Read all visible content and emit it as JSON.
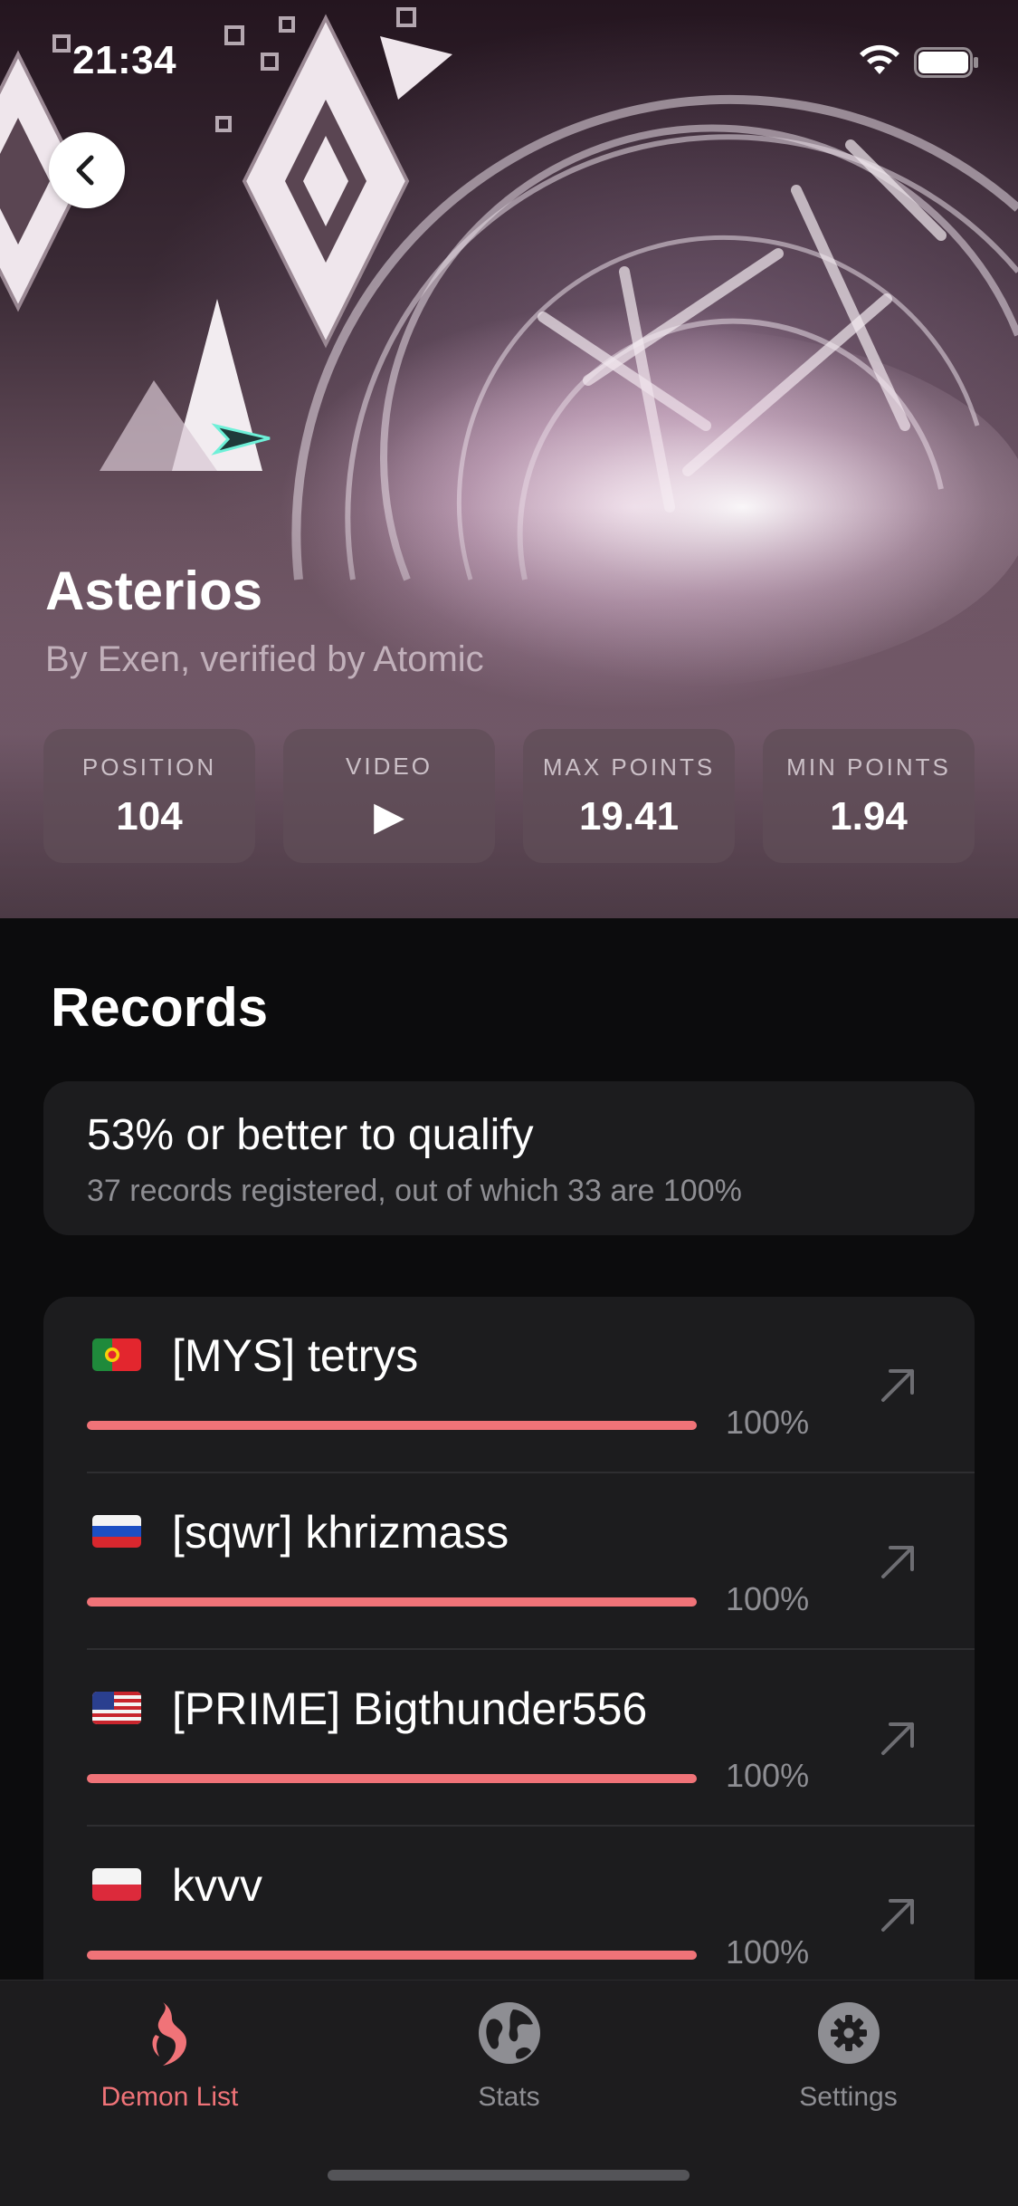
{
  "status_bar": {
    "time": "21:34"
  },
  "level": {
    "title": "Asterios",
    "subtitle": "By Exen, verified by Atomic"
  },
  "stats": [
    {
      "label": "POSITION",
      "value": "104"
    },
    {
      "label": "VIDEO",
      "value": "▶"
    },
    {
      "label": "MAX POINTS",
      "value": "19.41"
    },
    {
      "label": "MIN POINTS",
      "value": "1.94"
    }
  ],
  "records": {
    "heading": "Records",
    "qualify_title": "53% or better to qualify",
    "qualify_subtitle": "37 records registered, out of which 33 are 100%",
    "items": [
      {
        "flag": "portugal-flag",
        "name": "[MYS] tetrys",
        "percent": "100%",
        "progress": 1.0
      },
      {
        "flag": "russia-flag",
        "name": "[sqwr] khrizmass",
        "percent": "100%",
        "progress": 1.0
      },
      {
        "flag": "usa-flag",
        "name": "[PRIME] Bigthunder556",
        "percent": "100%",
        "progress": 1.0
      },
      {
        "flag": "poland-flag",
        "name": "kvvv",
        "percent": "100%",
        "progress": 1.0
      }
    ]
  },
  "tabs": [
    {
      "label": "Demon List",
      "icon": "demon-icon",
      "active": true
    },
    {
      "label": "Stats",
      "icon": "globe-icon",
      "active": false
    },
    {
      "label": "Settings",
      "icon": "gear-icon",
      "active": false
    }
  ],
  "colors": {
    "accent": "#f07378",
    "background": "#0c0c0d",
    "card": "#1c1c1e",
    "secondary_text": "#8e8e93",
    "inactive_tab": "#8e8e93"
  }
}
